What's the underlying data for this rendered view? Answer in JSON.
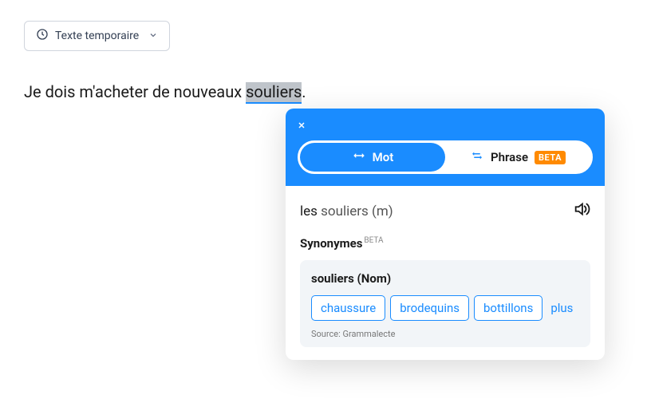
{
  "topButton": {
    "label": "Texte temporaire"
  },
  "sentence": {
    "pre": "Je dois m'acheter de nouveaux ",
    "highlight": "souliers",
    "post": "."
  },
  "popup": {
    "tabs": {
      "word": "Mot",
      "phrase": "Phrase",
      "beta": "BETA"
    },
    "word": {
      "article": "les",
      "main": "souliers",
      "gender": "(m)"
    },
    "synTitle": "Synonymes",
    "synBeta": "BETA",
    "synBox": {
      "headWord": "souliers",
      "headType": "(Nom)",
      "chips": [
        "chaussure",
        "brodequins",
        "bottillons"
      ],
      "more": "plus",
      "source": "Source: Grammalecte"
    }
  }
}
